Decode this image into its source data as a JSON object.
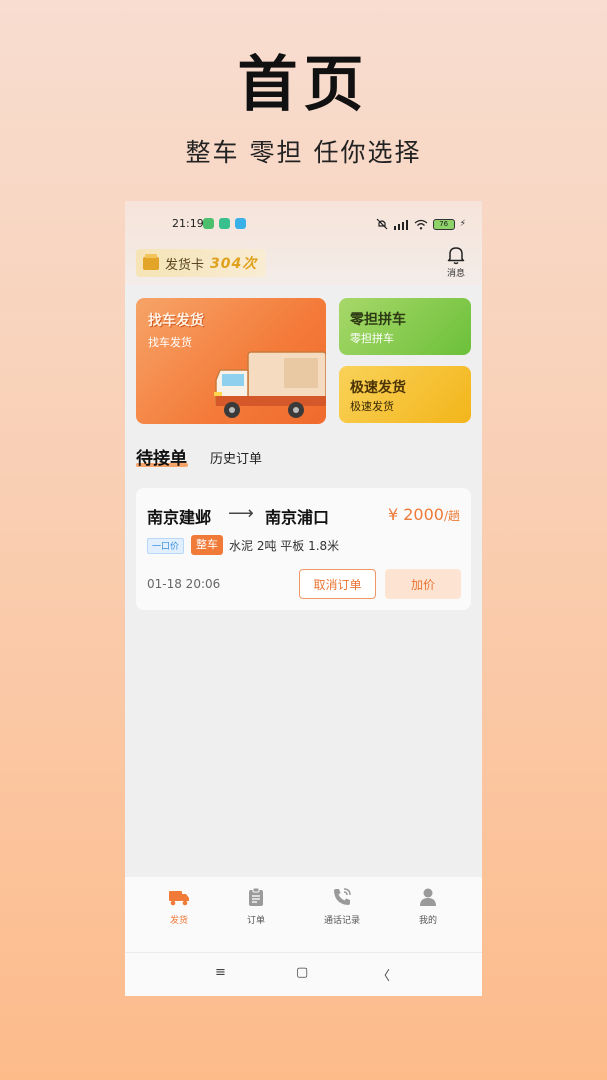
{
  "promo": {
    "title": "首页",
    "subtitle": "整车 零担 任你选择"
  },
  "status_bar": {
    "time": "21:19",
    "battery": "76"
  },
  "header": {
    "ship_card_label": "发货卡",
    "ship_card_count": "304次",
    "notification_label": "消息"
  },
  "banners": {
    "main": {
      "heading": "找车发货",
      "subtitle": "找车发货"
    },
    "carpool": {
      "heading": "零担拼车",
      "subtitle": "零担拼车"
    },
    "express": {
      "heading": "极速发货",
      "subtitle": "极速发货"
    }
  },
  "tabs": {
    "pending": "待接单",
    "history": "历史订单"
  },
  "order": {
    "from": "南京建邺",
    "arrow": "⟶",
    "to": "南京浦口",
    "price": "¥ 2000",
    "price_unit": "/趟",
    "fixed_price_tag": "一口价",
    "vehicle_type_tag": "整车",
    "description": "水泥 2吨 平板 1.8米",
    "time": "01-18 20:06",
    "cancel_label": "取消订单",
    "raise_label": "加价"
  },
  "tabbar": [
    {
      "label": "发货",
      "icon": "truck-icon",
      "active": true
    },
    {
      "label": "订单",
      "icon": "clipboard-icon",
      "active": false
    },
    {
      "label": "通话记录",
      "icon": "phone-icon",
      "active": false
    },
    {
      "label": "我的",
      "icon": "user-icon",
      "active": false
    }
  ],
  "navbar": {
    "menu": "≡",
    "home": "▢",
    "back": "〈"
  },
  "colors": {
    "accent": "#f07a38",
    "accent_light": "#fde4d2",
    "carpool": "#6cc03a",
    "express": "#f3b51a"
  }
}
